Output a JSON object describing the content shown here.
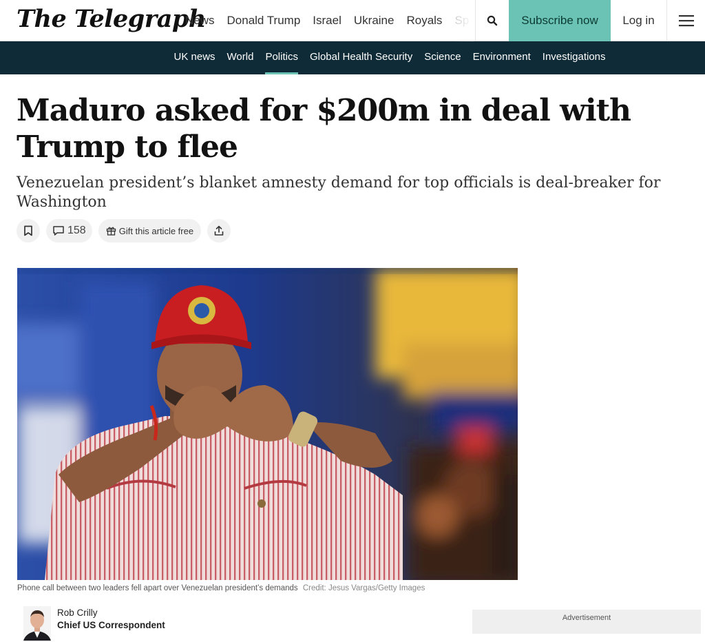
{
  "header": {
    "logo": "The Telegraph",
    "nav": [
      "News",
      "Donald Trump",
      "Israel",
      "Ukraine",
      "Royals",
      "Sp"
    ],
    "subscribe_label": "Subscribe now",
    "login_label": "Log in"
  },
  "section_nav": {
    "items": [
      "UK news",
      "World",
      "Politics",
      "Global Health Security",
      "Science",
      "Environment",
      "Investigations"
    ],
    "active": "Politics"
  },
  "article": {
    "headline": "Maduro asked for $200m in deal with Trump to flee",
    "standfirst": "Venezuelan president’s blanket amnesty demand for top officials is deal-breaker for Washington",
    "actions": {
      "comment_count": "158",
      "gift_label": "Gift this article free"
    },
    "image": {
      "caption": "Phone call between two leaders fell apart over Venezuelan president’s demands",
      "credit": "Credit: Jesus Vargas/Getty Images"
    },
    "byline": {
      "name": "Rob Crilly",
      "role": "Chief US Correspondent"
    }
  },
  "advert_label": "Advertisement",
  "colors": {
    "section_bar": "#0f2b38",
    "accent": "#6ac3b4"
  },
  "icons": [
    "search-icon",
    "menu-icon",
    "bookmark-icon",
    "comment-icon",
    "gift-icon",
    "share-icon"
  ]
}
